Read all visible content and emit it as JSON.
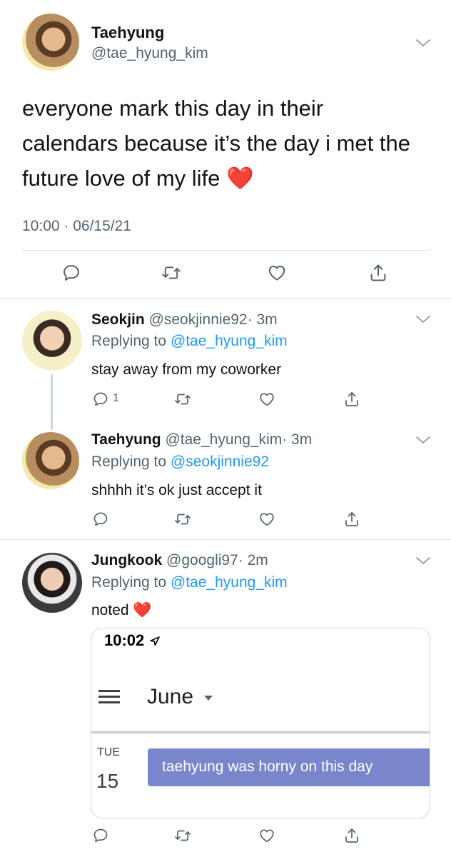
{
  "main_tweet": {
    "author_name": "Taehyung",
    "author_handle": "@tae_hyung_kim",
    "text": "everyone mark this day in their calendars because it’s the day i met the future love of my life",
    "emoji": "❤️",
    "timestamp": "10:00 · 06/15/21"
  },
  "replies": [
    {
      "author_name": "Seokjin",
      "author_handle": "@seokjinnie92",
      "age": "· 3m",
      "replying_prefix": "Replying to",
      "replying_to": "@tae_hyung_kim",
      "text": "stay away from my coworker",
      "reply_count": "1"
    },
    {
      "author_name": "Taehyung",
      "author_handle": "@tae_hyung_kim",
      "age": "· 3m",
      "replying_prefix": "Replying to",
      "replying_to": "@seokjinnie92",
      "text": "shhhh it’s ok just accept it"
    },
    {
      "author_name": "Jungkook",
      "author_handle": "@googli97",
      "age": "· 2m",
      "replying_prefix": "Replying to",
      "replying_to": "@tae_hyung_kim",
      "text": "noted",
      "emoji": "❤️",
      "attachment": {
        "status_time": "10:02",
        "month": "June",
        "weekday": "TUE",
        "day": "15",
        "event": "taehyung was horny on this day",
        "event_color": "#7986cb"
      }
    }
  ],
  "colors": {
    "accent": "#1d9bf0",
    "muted": "#536471",
    "heart": "#e0245e"
  }
}
